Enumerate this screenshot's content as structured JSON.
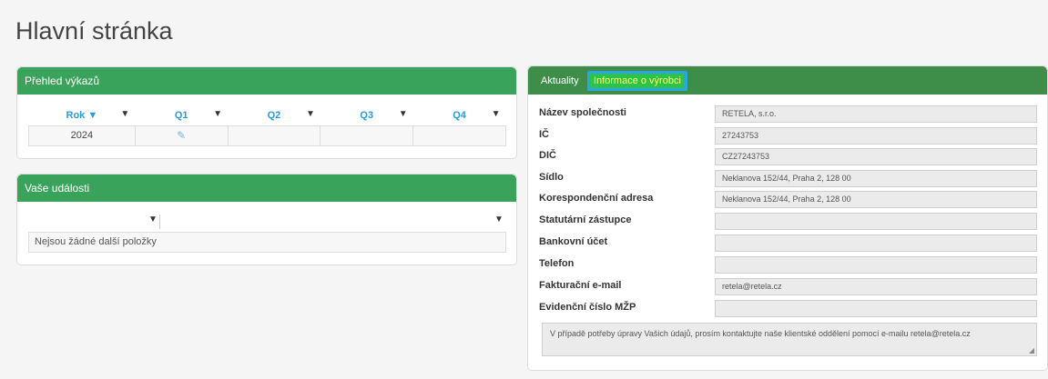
{
  "page": {
    "title": "Hlavní stránka"
  },
  "reports": {
    "header": "Přehled výkazů",
    "columns": [
      "Rok ▼",
      "Q1",
      "Q2",
      "Q3",
      "Q4"
    ],
    "rows": [
      {
        "year": "2024"
      }
    ],
    "filter_icon": "▼"
  },
  "events": {
    "header": "Vaše události",
    "empty_text": "Nejsou žádné další položky"
  },
  "info": {
    "tabs": [
      "Aktuality",
      "Informace o výrobci"
    ],
    "fields": [
      {
        "label": "Název společnosti",
        "value": "RETELA, s.r.o."
      },
      {
        "label": "IČ",
        "value": "27243753"
      },
      {
        "label": "DIČ",
        "value": "CZ27243753"
      },
      {
        "label": "Sídlo",
        "value": "Neklanova 152/44, Praha 2, 128 00"
      },
      {
        "label": "Korespondenční adresa",
        "value": "Neklanova 152/44, Praha 2, 128 00"
      },
      {
        "label": "Statutární zástupce",
        "value": ""
      },
      {
        "label": "Bankovní účet",
        "value": ""
      },
      {
        "label": "Telefon",
        "value": ""
      },
      {
        "label": "Fakturační e-mail",
        "value": "retela@retela.cz"
      },
      {
        "label": "Evidenční číslo MŽP",
        "value": ""
      }
    ],
    "note": "V případě potřeby úpravy Vašich údajů, prosím kontaktujte naše klientské oddělení pomocí e-mailu retela@retela.cz"
  }
}
